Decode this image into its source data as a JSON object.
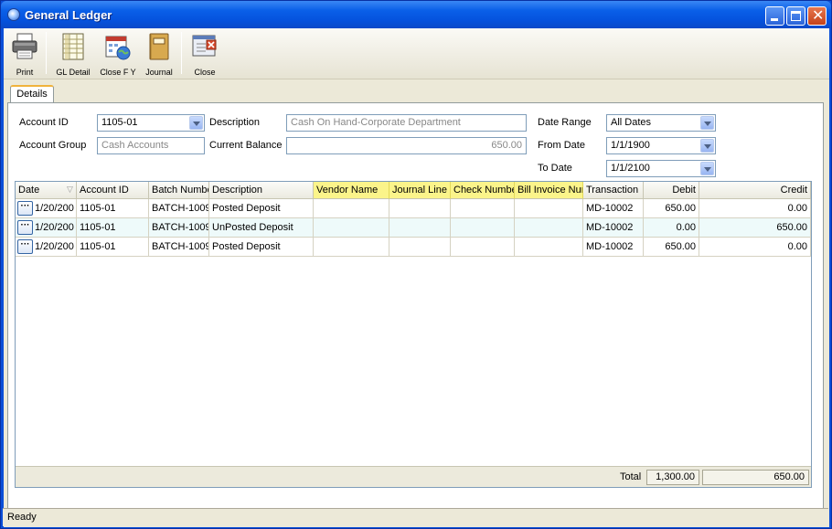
{
  "window": {
    "title": "General Ledger"
  },
  "toolbar": {
    "print": "Print",
    "gl_detail": "GL Detail",
    "close_fy": "Close F Y",
    "journal": "Journal",
    "close": "Close"
  },
  "tab": {
    "details": "Details"
  },
  "form": {
    "account_id_label": "Account ID",
    "account_id_value": "1105-01",
    "account_group_label": "Account Group",
    "account_group_value": "Cash Accounts",
    "description_label": "Description",
    "description_value": "Cash On Hand-Corporate Department",
    "current_balance_label": "Current Balance",
    "current_balance_value": "650.00",
    "date_range_label": "Date Range",
    "date_range_value": "All Dates",
    "from_date_label": "From Date",
    "from_date_value": "1/1/1900",
    "to_date_label": "To Date",
    "to_date_value": "1/1/2100"
  },
  "grid": {
    "columns": [
      "Date",
      "Account ID",
      "Batch Number",
      "Description",
      "Vendor Name",
      "Journal Line",
      "Check Number",
      "Bill Invoice Number",
      "Transaction",
      "Debit",
      "Credit"
    ],
    "rows": [
      {
        "date": "1/20/200",
        "account_id": "1105-01",
        "batch": "BATCH-1009",
        "description": "Posted Deposit",
        "vendor": "",
        "journal_line": "",
        "check": "",
        "bill_invoice": "",
        "transaction": "MD-10002",
        "debit": "650.00",
        "credit": "0.00"
      },
      {
        "date": "1/20/200",
        "account_id": "1105-01",
        "batch": "BATCH-1009",
        "description": "UnPosted Deposit",
        "vendor": "",
        "journal_line": "",
        "check": "",
        "bill_invoice": "",
        "transaction": "MD-10002",
        "debit": "0.00",
        "credit": "650.00"
      },
      {
        "date": "1/20/200",
        "account_id": "1105-01",
        "batch": "BATCH-1009",
        "description": "Posted Deposit",
        "vendor": "",
        "journal_line": "",
        "check": "",
        "bill_invoice": "",
        "transaction": "MD-10002",
        "debit": "650.00",
        "credit": "0.00"
      }
    ],
    "total_label": "Total",
    "total_debit": "1,300.00",
    "total_credit": "650.00"
  },
  "status": {
    "text": "Ready"
  },
  "colors": {
    "highlight": "#fbf48a",
    "titlebar": "#0553de",
    "alt_row": "#eefafa"
  }
}
